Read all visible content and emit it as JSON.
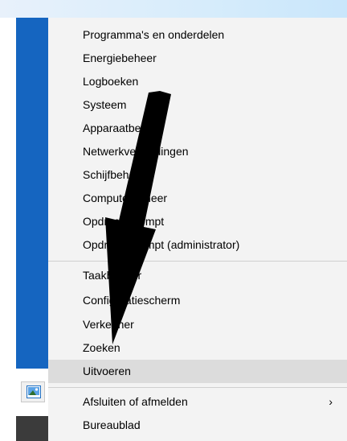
{
  "menu": {
    "group1": [
      {
        "label": "Programma's en onderdelen"
      },
      {
        "label": "Energiebeheer"
      },
      {
        "label": "Logboeken"
      },
      {
        "label": "Systeem"
      },
      {
        "label": "Apparaatbeheer"
      },
      {
        "label": "Netwerkverbindingen"
      },
      {
        "label": "Schijfbeheer"
      },
      {
        "label": "Computerbeheer"
      },
      {
        "label": "Opdrachtprompt"
      },
      {
        "label": "Opdrachtprompt (administrator)"
      }
    ],
    "group2": [
      {
        "label": "Taakbeheer"
      },
      {
        "label": "Configuratiescherm"
      },
      {
        "label": "Verkenner"
      },
      {
        "label": "Zoeken"
      },
      {
        "label": "Uitvoeren"
      }
    ],
    "group3": [
      {
        "label": "Afsluiten of afmelden",
        "chevron": "›"
      },
      {
        "label": "Bureaublad"
      }
    ]
  },
  "highlighted_item": "Uitvoeren",
  "colors": {
    "menu_bg": "#f3f3f3",
    "highlight": "#dcdcdc",
    "left_bar": "#1565c0",
    "arrow": "#000000"
  },
  "icons": {
    "taskbar": "picture-icon",
    "annotation": "arrow-annotation-icon"
  }
}
